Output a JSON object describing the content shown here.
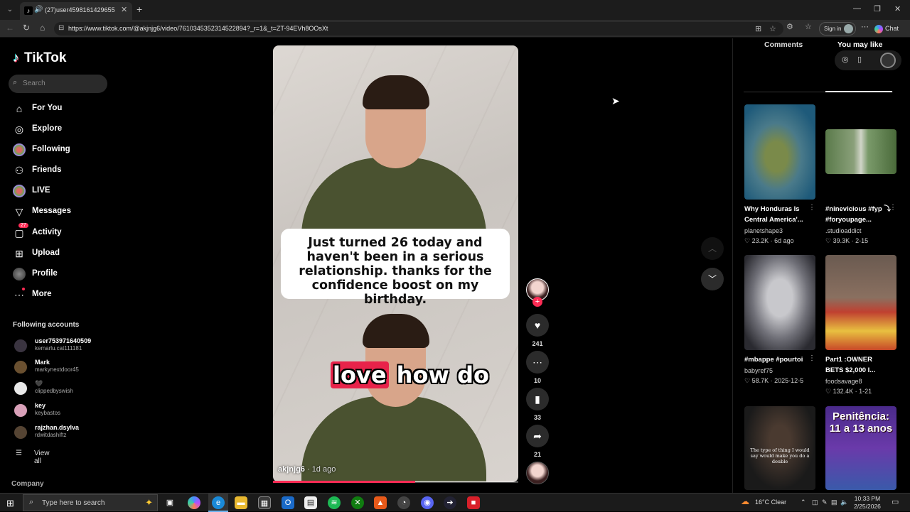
{
  "browser": {
    "tab_title": "(27)user4598161429655 (@ak",
    "url": "https://www.tiktok.com/@akjnjg6/video/7610345352314522894?_r=1&_t=ZT-94EVh8OOsXt",
    "signin_label": "Sign in",
    "chat_label": "Chat"
  },
  "sidebar": {
    "logo": "TikTok",
    "search_placeholder": "Search",
    "nav": [
      {
        "label": "For You",
        "icon": "home-icon"
      },
      {
        "label": "Explore",
        "icon": "compass-icon"
      },
      {
        "label": "Following",
        "icon": "following-avatar-icon"
      },
      {
        "label": "Friends",
        "icon": "friends-icon"
      },
      {
        "label": "LIVE",
        "icon": "live-icon"
      },
      {
        "label": "Messages",
        "icon": "messages-icon"
      },
      {
        "label": "Activity",
        "icon": "activity-icon",
        "badge": "27"
      },
      {
        "label": "Upload",
        "icon": "upload-icon"
      },
      {
        "label": "Profile",
        "icon": "profile-icon"
      },
      {
        "label": "More",
        "icon": "more-icon"
      }
    ],
    "following_title": "Following accounts",
    "accounts": [
      {
        "name": "user7539716405​09",
        "handle": "kemarlu.cat111181"
      },
      {
        "name": "Mark",
        "handle": "markynextdoor45"
      },
      {
        "name": "🖤",
        "handle": "clippedbyswish"
      },
      {
        "name": "key",
        "handle": "keybastos"
      },
      {
        "name": "rajzhan.dsylva",
        "handle": "rdwitdashiftz"
      }
    ],
    "view_all": "View all",
    "company": "Company"
  },
  "video": {
    "caption": "Just turned 26 today and haven't been in a serious relationship. thanks for the confidence boost on my birthday.",
    "subtitle_highlight": "love",
    "subtitle_rest": "how do",
    "author": "akjnjg6",
    "ago": "· 1d ago",
    "progress": 0.58
  },
  "actions": {
    "likes": "241",
    "comments": "10",
    "saves": "33",
    "shares": "21"
  },
  "right_panel": {
    "tabs": [
      "Comments",
      "You may like"
    ],
    "active_tab": "You may like",
    "cards": [
      {
        "title": "Why Honduras Is Central America'...",
        "user": "planetshape3",
        "likes": "23.2K",
        "date": "6d ago"
      },
      {
        "title": "#ninevicious #fyp ⤵ #foryoupage...",
        "user": ".studioaddict",
        "likes": "39.3K",
        "date": "2-15"
      },
      {
        "title": "#mbappe #pourtoi",
        "user": "babyref75",
        "likes": "58.7K",
        "date": "2025-12-5"
      },
      {
        "title": "Part1 :OWNER BETS $2,000 I...",
        "user": "foodsavage8",
        "likes": "132.4K",
        "date": "1-21"
      }
    ],
    "card5_overlay": "The type of thing I would say would make you do a double",
    "card6_overlay": "Penitência: 11 a 13 anos"
  },
  "taskbar": {
    "search_placeholder": "Type here to search",
    "weather": "16°C  Clear",
    "time": "10:33 PM",
    "date": "2/25/2026"
  }
}
